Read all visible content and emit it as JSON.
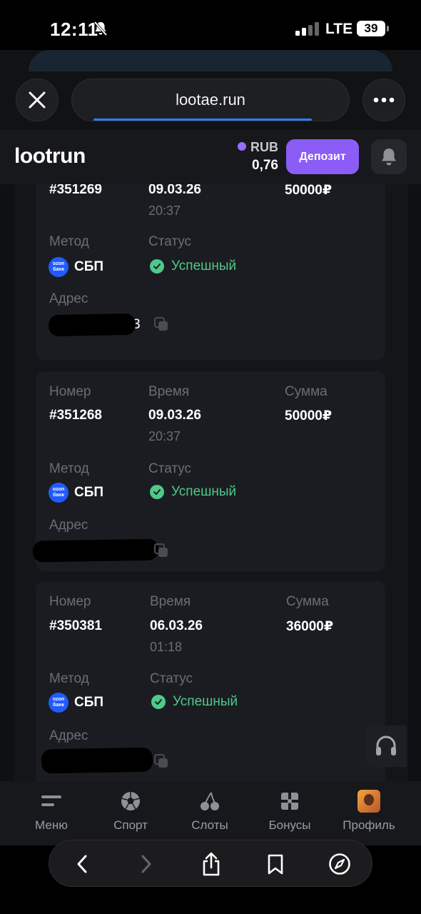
{
  "status_bar": {
    "time": "12:11",
    "network": "LTE",
    "battery": "39"
  },
  "browser": {
    "url": "lootae.run",
    "load_progress": 0.8
  },
  "header": {
    "logo": "lootrun",
    "currency": "RUB",
    "balance": "0,76",
    "deposit_label": "Депозит"
  },
  "labels": {
    "number": "Номер",
    "time": "Время",
    "amount": "Сумма",
    "method": "Метод",
    "status": "Статус",
    "address": "Адрес"
  },
  "transactions": [
    {
      "number": "#351269",
      "date": "09.03.26",
      "time": "20:37",
      "amount": "50000₽",
      "method": "СБП",
      "bank_logo_top": "ozon",
      "bank_logo_bottom": "банк",
      "status": "Успешный",
      "address_tail": "3"
    },
    {
      "number": "#351268",
      "date": "09.03.26",
      "time": "20:37",
      "amount": "50000₽",
      "method": "СБП",
      "bank_logo_top": "ozon",
      "bank_logo_bottom": "банк",
      "status": "Успешный",
      "address_tail": ""
    },
    {
      "number": "#350381",
      "date": "06.03.26",
      "time": "01:18",
      "amount": "36000₽",
      "method": "СБП",
      "bank_logo_top": "ozon",
      "bank_logo_bottom": "банк",
      "status": "Успешный",
      "address_tail": ""
    }
  ],
  "bottom_nav": [
    {
      "label": "Меню",
      "icon": "menu-icon"
    },
    {
      "label": "Спорт",
      "icon": "soccer-ball-icon"
    },
    {
      "label": "Слоты",
      "icon": "cherries-icon"
    },
    {
      "label": "Бонусы",
      "icon": "gift-icon"
    },
    {
      "label": "Профиль",
      "icon": "avatar"
    }
  ],
  "colors": {
    "accent": "#8b5cf6",
    "success": "#4fc98a",
    "link_progress": "#2f7df6",
    "ozon_blue": "#1f5bff"
  }
}
